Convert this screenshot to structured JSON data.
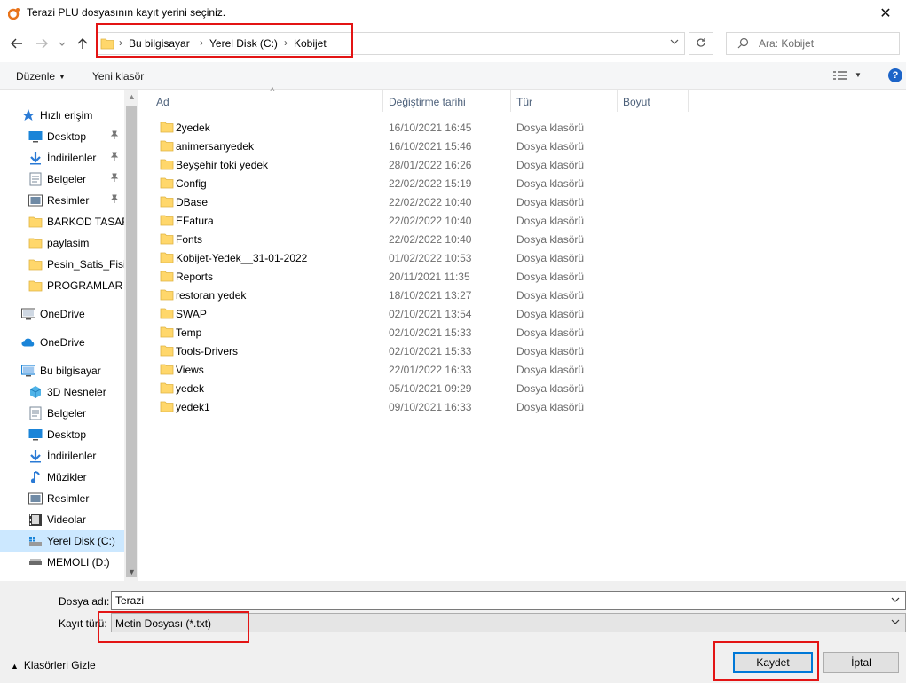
{
  "window": {
    "title": "Terazi PLU dosyasının kayıt yerini seçiniz.",
    "close_glyph": "✕"
  },
  "address": {
    "crumbs": [
      "Bu bilgisayar",
      "Yerel Disk (C:)",
      "Kobijet"
    ]
  },
  "search": {
    "placeholder": "Ara: Kobijet"
  },
  "toolbar": {
    "organize_label": "Düzenle",
    "new_folder_label": "Yeni klasör",
    "help_label": "?"
  },
  "nav": {
    "items": [
      {
        "label": "Hızlı erişim",
        "icon": "star-icon"
      },
      {
        "label": "Desktop",
        "icon": "desktop-icon",
        "pinned": true
      },
      {
        "label": "İndirilenler",
        "icon": "download-icon",
        "pinned": true
      },
      {
        "label": "Belgeler",
        "icon": "documents-icon",
        "pinned": true
      },
      {
        "label": "Resimler",
        "icon": "pictures-icon",
        "pinned": true
      },
      {
        "label": "BARKOD TASARI",
        "icon": "folder-icon"
      },
      {
        "label": "paylasim",
        "icon": "folder-icon"
      },
      {
        "label": "Pesin_Satis_Fisi",
        "icon": "folder-icon"
      },
      {
        "label": "PROGRAMLAR",
        "icon": "folder-icon"
      },
      {
        "label": "OneDrive",
        "icon": "onedrive-icon"
      },
      {
        "label": "OneDrive",
        "icon": "cloud-icon"
      },
      {
        "label": "Bu bilgisayar",
        "icon": "computer-icon"
      },
      {
        "label": "3D Nesneler",
        "icon": "3d-objects-icon"
      },
      {
        "label": "Belgeler",
        "icon": "documents-icon"
      },
      {
        "label": "Desktop",
        "icon": "desktop-icon"
      },
      {
        "label": "İndirilenler",
        "icon": "download-icon"
      },
      {
        "label": "Müzikler",
        "icon": "music-icon"
      },
      {
        "label": "Resimler",
        "icon": "pictures-icon"
      },
      {
        "label": "Videolar",
        "icon": "videos-icon"
      },
      {
        "label": "Yerel Disk (C:)",
        "icon": "drive-icon",
        "selected": true
      },
      {
        "label": "MEMOLI (D:)",
        "icon": "removable-drive-icon"
      }
    ]
  },
  "columns": {
    "name": "Ad",
    "date": "Değiştirme tarihi",
    "type": "Tür",
    "size": "Boyut"
  },
  "files": [
    {
      "name": "2yedek",
      "date": "16/10/2021 16:45",
      "type": "Dosya klasörü"
    },
    {
      "name": "animersanyedek",
      "date": "16/10/2021 15:46",
      "type": "Dosya klasörü"
    },
    {
      "name": "Beyşehir toki yedek",
      "date": "28/01/2022 16:26",
      "type": "Dosya klasörü"
    },
    {
      "name": "Config",
      "date": "22/02/2022 15:19",
      "type": "Dosya klasörü"
    },
    {
      "name": "DBase",
      "date": "22/02/2022 10:40",
      "type": "Dosya klasörü"
    },
    {
      "name": "EFatura",
      "date": "22/02/2022 10:40",
      "type": "Dosya klasörü"
    },
    {
      "name": "Fonts",
      "date": "22/02/2022 10:40",
      "type": "Dosya klasörü"
    },
    {
      "name": "Kobijet-Yedek__31-01-2022",
      "date": "01/02/2022 10:53",
      "type": "Dosya klasörü"
    },
    {
      "name": "Reports",
      "date": "20/11/2021 11:35",
      "type": "Dosya klasörü"
    },
    {
      "name": "restoran yedek",
      "date": "18/10/2021 13:27",
      "type": "Dosya klasörü"
    },
    {
      "name": "SWAP",
      "date": "02/10/2021 13:54",
      "type": "Dosya klasörü"
    },
    {
      "name": "Temp",
      "date": "02/10/2021 15:33",
      "type": "Dosya klasörü"
    },
    {
      "name": "Tools-Drivers",
      "date": "02/10/2021 15:33",
      "type": "Dosya klasörü"
    },
    {
      "name": "Views",
      "date": "22/01/2022 16:33",
      "type": "Dosya klasörü"
    },
    {
      "name": "yedek",
      "date": "05/10/2021 09:29",
      "type": "Dosya klasörü"
    },
    {
      "name": "yedek1",
      "date": "09/10/2021 16:33",
      "type": "Dosya klasörü"
    }
  ],
  "form": {
    "filename_label": "Dosya adı:",
    "filename_value": "Terazi",
    "filetype_label": "Kayıt türü:",
    "filetype_value": "Metin Dosyası (*.txt)"
  },
  "footer": {
    "hide_folders_label": "Klasörleri Gizle",
    "save_label": "Kaydet",
    "cancel_label": "İptal"
  },
  "colors": {
    "highlight": "#e31414",
    "folder": "#ffd76b",
    "selected_bg": "#cce8ff",
    "accent": "#0078d7"
  }
}
